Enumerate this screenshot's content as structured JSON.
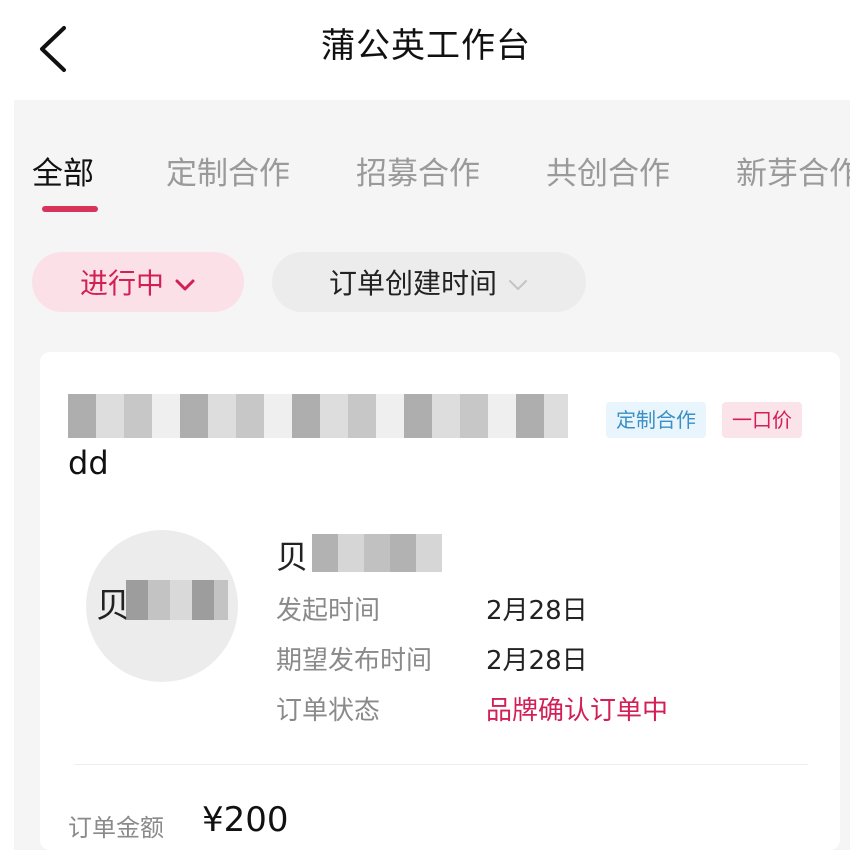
{
  "header": {
    "title": "蒲公英工作台",
    "back_icon": "chevron-left-icon"
  },
  "tabs": [
    {
      "label": "全部",
      "active": true
    },
    {
      "label": "定制合作",
      "active": false
    },
    {
      "label": "招募合作",
      "active": false
    },
    {
      "label": "共创合作",
      "active": false
    },
    {
      "label": "新芽合作",
      "active": false
    }
  ],
  "filters": {
    "status": {
      "label": "进行中",
      "icon": "chevron-down-icon"
    },
    "sort": {
      "label": "订单创建时间",
      "icon": "chevron-down-icon"
    }
  },
  "order": {
    "title_suffix": "dd",
    "tags": [
      "定制合作",
      "一口价"
    ],
    "avatar_text": "贝",
    "name_prefix": "贝",
    "fields": [
      {
        "label": "发起时间",
        "value": "2月28日"
      },
      {
        "label": "期望发布时间",
        "value": "2月28日"
      },
      {
        "label": "订单状态",
        "value": "品牌确认订单中"
      }
    ],
    "amount_label": "订单金额",
    "amount_value": "¥200"
  },
  "colors": {
    "accent": "#d21f55",
    "chip_bg": "#fbe1e7",
    "tag_blue_text": "#3a8fc4",
    "tag_blue_bg": "#e9f5fc"
  }
}
